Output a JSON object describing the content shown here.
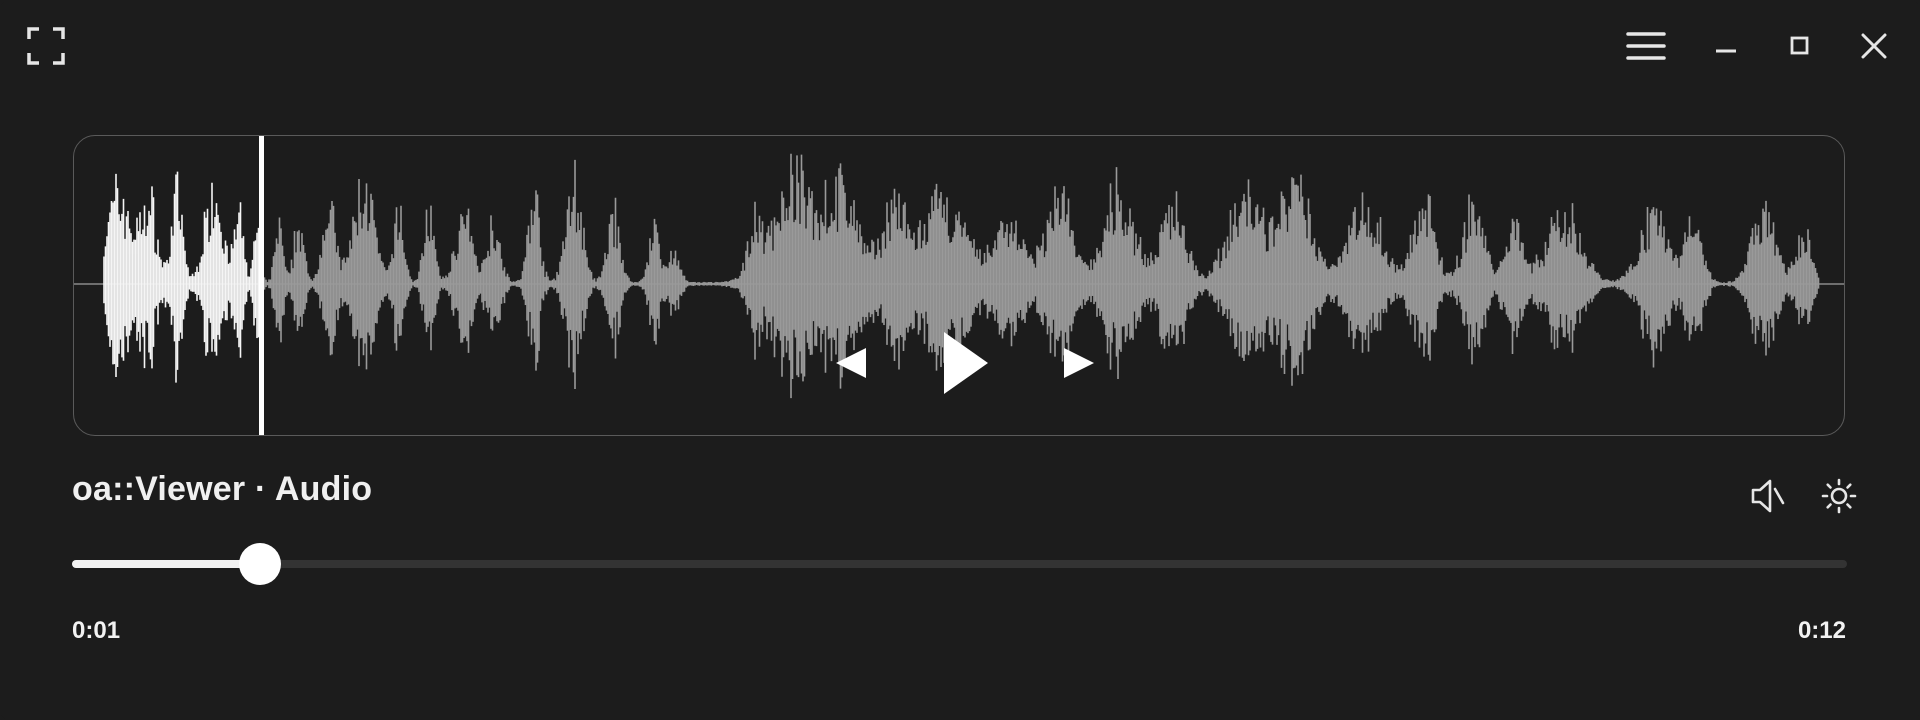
{
  "window": {
    "title": "oa::Viewer · Audio",
    "icons": {
      "fullscreen": "fullscreen-icon",
      "menu": "hamburger-menu-icon",
      "minimize": "minimize-icon",
      "maximize": "maximize-icon",
      "close": "close-icon"
    }
  },
  "player": {
    "transport_icons": [
      "previous-icon",
      "play-icon",
      "next-icon"
    ],
    "state": "paused",
    "current_time": "0:01",
    "total_time": "0:12",
    "progress": 0.106,
    "controls_icons": [
      "volume-icon",
      "brightness-settings-icon"
    ]
  },
  "waveform": {
    "played_color": "#f5f5f5",
    "unplayed_color": "#9a9a9a",
    "playhead_color": "#ffffff"
  },
  "colors": {
    "background": "#1c1c1c",
    "panel_border": "#5a5a5a",
    "track": "#333333",
    "track_fill": "#f2f2f2"
  }
}
